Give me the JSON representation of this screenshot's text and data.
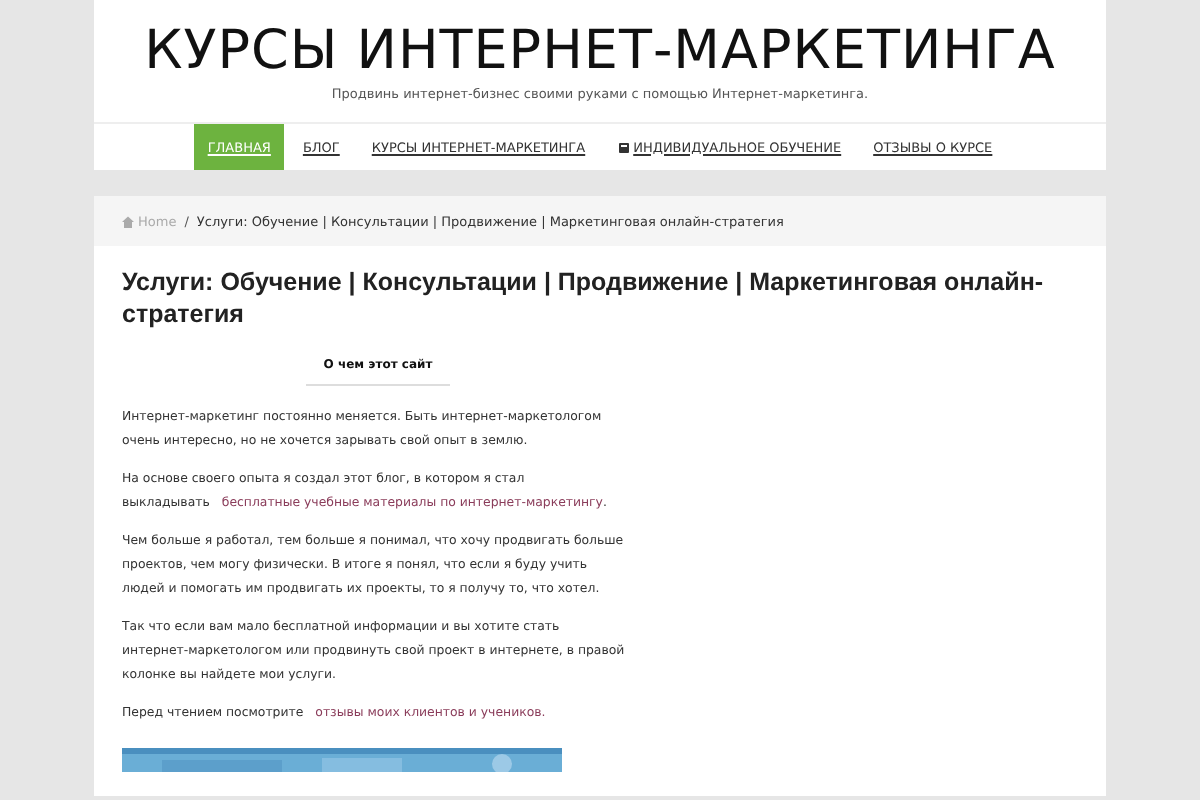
{
  "header": {
    "title": "КУРСЫ ИНТЕРНЕТ-МАРКЕТИНГА",
    "tagline": "Продвинь интернет-бизнес своими руками с помощью Интернет-маркетинга."
  },
  "nav": [
    {
      "label": "ГЛАВНАЯ",
      "selected": true,
      "icon": false
    },
    {
      "label": "БЛОГ",
      "selected": false,
      "icon": false
    },
    {
      "label": "КУРСЫ ИНТЕРНЕТ-МАРКЕТИНГА",
      "selected": false,
      "icon": false
    },
    {
      "label": "ИНДИВИДУАЛЬНОЕ ОБУЧЕНИЕ",
      "selected": false,
      "icon": true
    },
    {
      "label": "ОТЗЫВЫ О КУРСЕ",
      "selected": false,
      "icon": false
    }
  ],
  "breadcrumb": {
    "home": "Home",
    "separator": "/",
    "current": "Услуги: Обучение | Консультации | Продвижение | Маркетинговая онлайн-стратегия"
  },
  "article": {
    "title": "Услуги: Обучение | Консультации | Продвижение | Маркетинговая онлайн-стратегия",
    "tab": "О чем этот сайт",
    "paragraphs": [
      {
        "text": "Интернет-маркетинг постоянно меняется. Быть интернет-маркетологом очень интересно, но не хочется зарывать свой опыт в землю."
      },
      {
        "text": "На основе своего опыта я создал этот блог, в котором я стал выкладывать",
        "link": "бесплатные учебные материалы по интернет-маркетингу",
        "after": "."
      },
      {
        "text": "Чем больше я работал, тем больше я понимал, что хочу продвигать больше проектов, чем могу физически. В итоге я понял, что если я буду учить людей и помогать им продвигать их проекты, то я получу то, что хотел."
      },
      {
        "text": "Так что если вам мало бесплатной информации и вы хотите стать интернет-маркетологом или продвинуть свой проект в интернете, в правой колонке вы найдете мои услуги."
      },
      {
        "text": "Перед чтением посмотрите",
        "link": "отзывы моих клиентов и учеников."
      }
    ]
  }
}
